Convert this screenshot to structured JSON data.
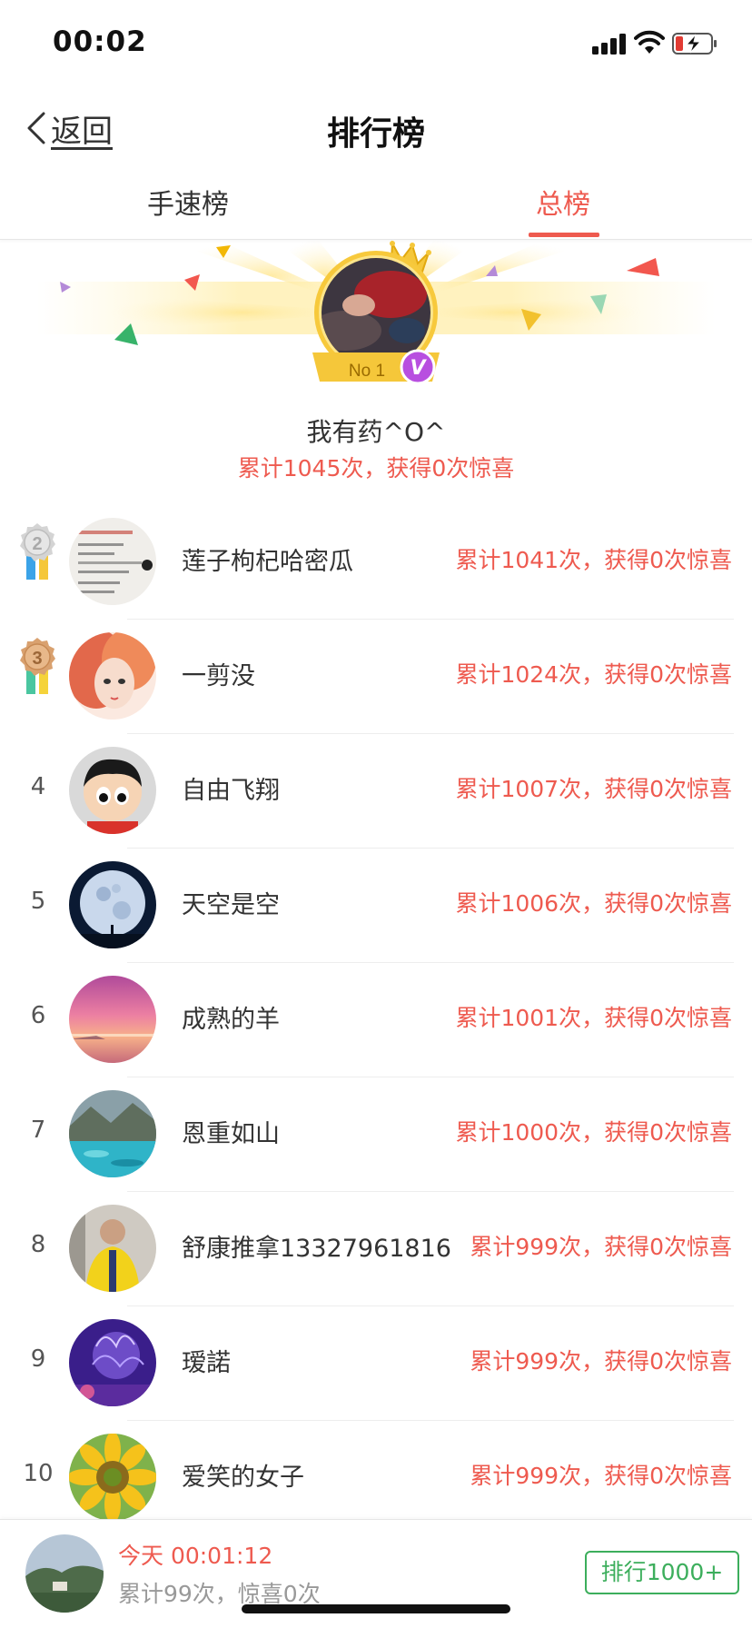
{
  "status_bar": {
    "time": "00:02"
  },
  "nav": {
    "back_label": "返回",
    "title": "排行榜"
  },
  "tabs": [
    {
      "label": "手速榜",
      "active": false
    },
    {
      "label": "总榜",
      "active": true
    }
  ],
  "champion": {
    "badge": "No 1",
    "verified_mark": "V",
    "name": "我有药^O^",
    "stats": "累计1045次，获得0次惊喜"
  },
  "ranking": [
    {
      "rank": "2",
      "medal": "silver",
      "name": "莲子枸杞哈密瓜",
      "stats": "累计1041次，获得0次惊喜"
    },
    {
      "rank": "3",
      "medal": "bronze",
      "name": "一剪没",
      "stats": "累计1024次，获得0次惊喜"
    },
    {
      "rank": "4",
      "name": "自由飞翔",
      "stats": "累计1007次，获得0次惊喜"
    },
    {
      "rank": "5",
      "name": "天空是空",
      "stats": "累计1006次，获得0次惊喜"
    },
    {
      "rank": "6",
      "name": "成熟的羊",
      "stats": "累计1001次，获得0次惊喜"
    },
    {
      "rank": "7",
      "name": "恩重如山",
      "stats": "累计1000次，获得0次惊喜"
    },
    {
      "rank": "8",
      "name": "舒康推拿13327961816",
      "stats": "累计999次，获得0次惊喜"
    },
    {
      "rank": "9",
      "name": "瑷諾",
      "stats": "累计999次，获得0次惊喜"
    },
    {
      "rank": "10",
      "name": "爱笑的女子",
      "stats": "累计999次，获得0次惊喜"
    }
  ],
  "me": {
    "today_line": "今天  00:01:12",
    "summary_line": "累计99次，惊喜0次",
    "rank_button": "排行1000+"
  },
  "colors": {
    "accent": "#ee5a4f",
    "green": "#3cae5c",
    "gold": "#f5c73a"
  },
  "icons": [
    "signal-icon",
    "wifi-icon",
    "battery-charging-icon",
    "chevron-left-icon",
    "crown-icon",
    "verified-badge-icon",
    "medal-icon"
  ]
}
